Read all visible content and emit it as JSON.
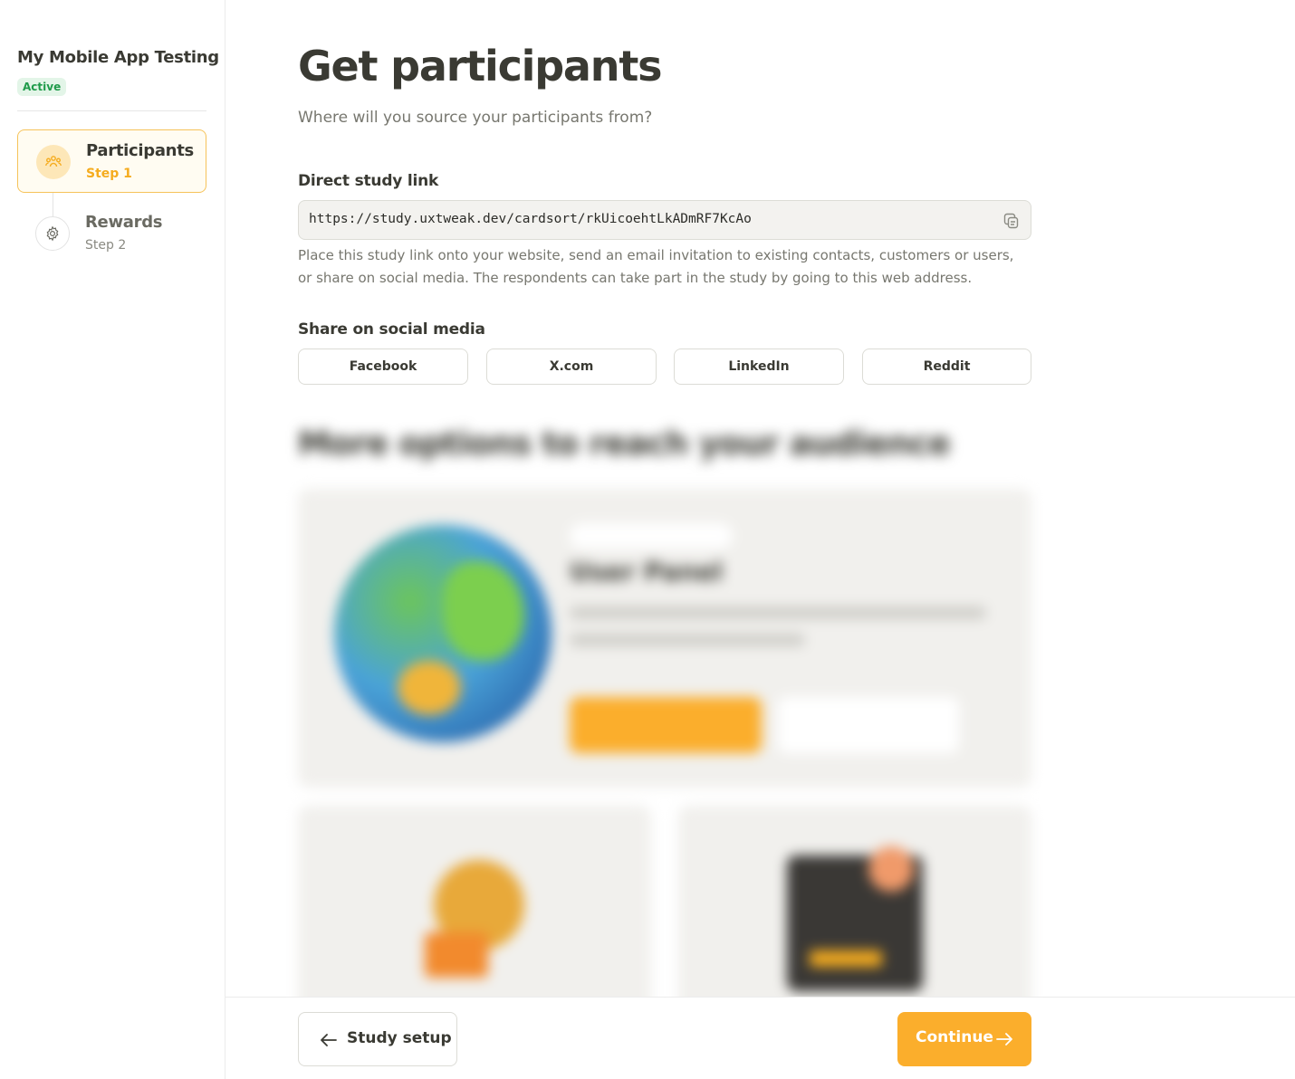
{
  "sidebar": {
    "project_title": "My Mobile App Testing",
    "status": "Active",
    "steps": [
      {
        "name": "Participants",
        "step": "Step 1",
        "icon": "participants-icon",
        "active": true
      },
      {
        "name": "Rewards",
        "step": "Step 2",
        "icon": "gear-icon",
        "active": false
      }
    ]
  },
  "main": {
    "title": "Get participants",
    "subtitle": "Where will you source your participants from?",
    "direct_link": {
      "label": "Direct study link",
      "url": "https://study.uxtweak.dev/cardsort/rkUicoehtLkADmRF7KcAo",
      "description": "Place this study link onto your website, send an email invitation to existing contacts, customers or users, or share on social media. The respondents can take part in the study by going to this web address.",
      "copy_icon": "copy-icon"
    },
    "social": {
      "label": "Share on social media",
      "buttons": [
        "Facebook",
        "X.com",
        "LinkedIn",
        "Reddit"
      ]
    },
    "more_options": {
      "title": "More options to reach your audience",
      "card_heading": "User Panel"
    }
  },
  "footer": {
    "back_label": "Study setup",
    "continue_label": "Continue"
  },
  "colors": {
    "accent": "#fbae2c",
    "active_border": "#f6c35a",
    "status_green": "#1f9b4a",
    "text_dark": "#3a3a33"
  }
}
